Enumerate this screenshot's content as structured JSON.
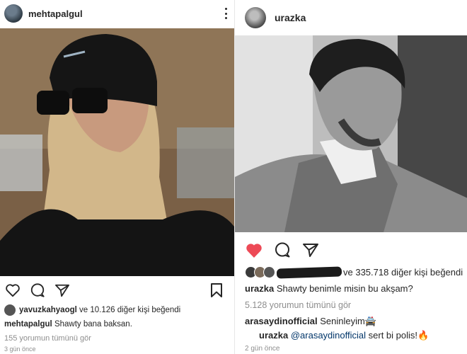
{
  "left_post": {
    "username": "mehtapalgul",
    "likes": {
      "user": "yavuzkahyaogl",
      "rest": "ve 10.126 diğer kişi beğendi"
    },
    "caption": {
      "user": "mehtapalgul",
      "text": "Shawty bana baksan."
    },
    "view_comments": "155 yorumun tümünü gör",
    "time": "3 gün önce"
  },
  "right_post": {
    "username": "urazka",
    "liked": true,
    "likes": {
      "rest": "ve 335.718 diğer kişi beğendi"
    },
    "caption": {
      "user": "urazka",
      "text": "Shawty benimle misin bu akşam?"
    },
    "view_comments": "5.128 yorumun tümünü gör",
    "comments": [
      {
        "user": "arasaydinofficial",
        "text": "Seninleyim🚔"
      },
      {
        "user": "urazka",
        "mention": "@arasaydinofficial",
        "text": "sert bi polis!🔥"
      }
    ],
    "time": "2 gün önce"
  },
  "colors": {
    "heart": "#ed4956",
    "text": "#262626",
    "muted": "#8e8e8e",
    "mention": "#003569"
  }
}
